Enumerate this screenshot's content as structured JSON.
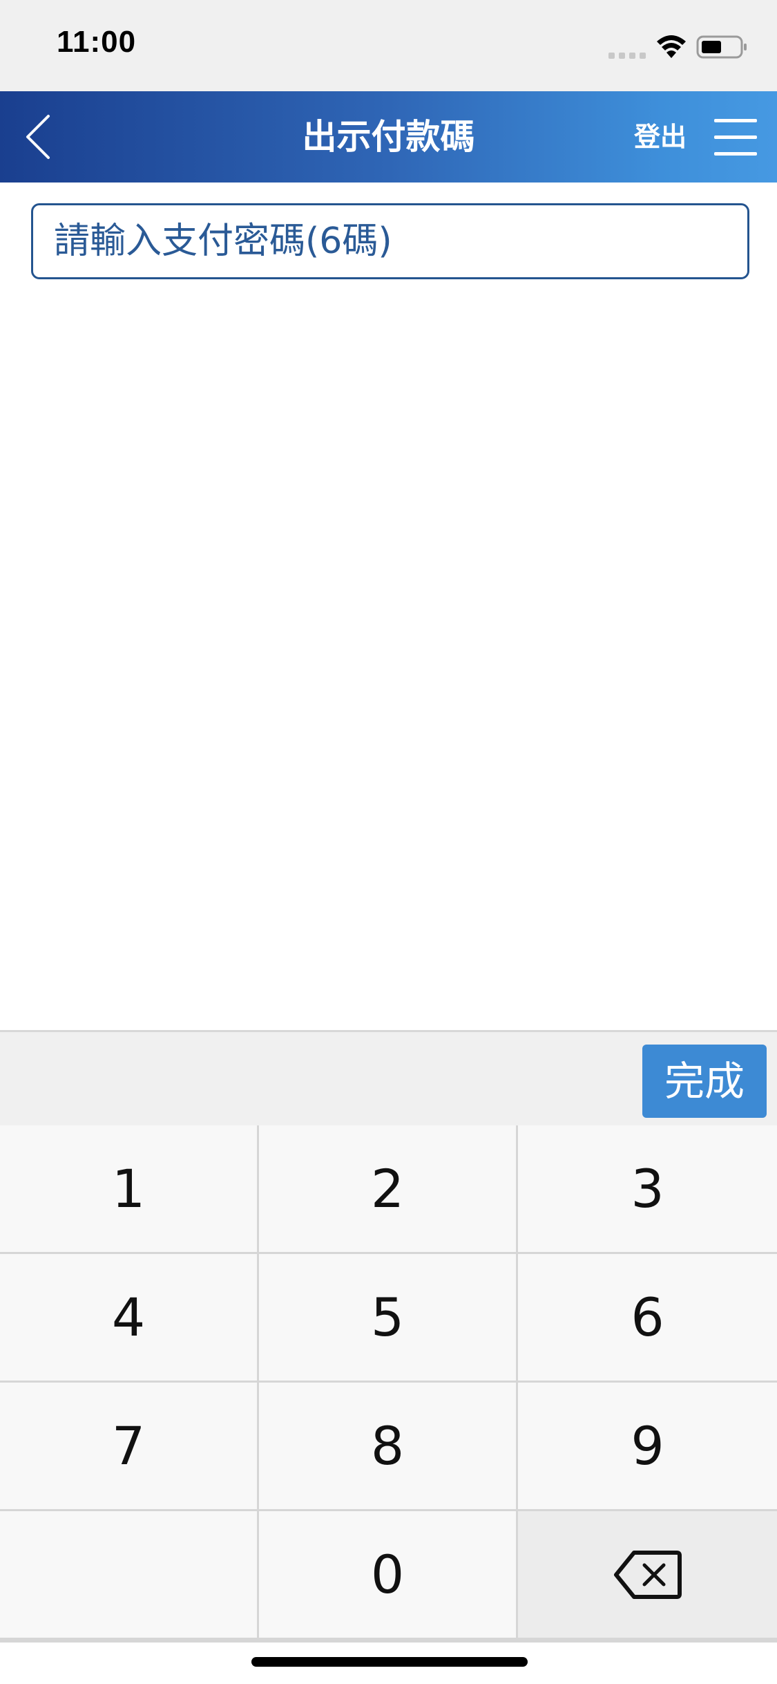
{
  "status_bar": {
    "time": "11:00",
    "icons": [
      "signal-icon",
      "wifi-icon",
      "battery-icon"
    ]
  },
  "nav": {
    "title": "出示付款碼",
    "logout_label": "登出",
    "icons": [
      "back-arrow-icon",
      "hamburger-menu-icon"
    ]
  },
  "password": {
    "placeholder": "請輸入支付密碼(6碼)",
    "value": ""
  },
  "keyboard": {
    "done_label": "完成",
    "keys": [
      "1",
      "2",
      "3",
      "4",
      "5",
      "6",
      "7",
      "8",
      "9",
      "",
      "0"
    ],
    "backspace_icon": "backspace-icon"
  },
  "colors": {
    "nav_gradient_start": "#1a3f8f",
    "nav_gradient_end": "#4699e2",
    "accent": "#3d8ad4",
    "field_border": "#24548f",
    "field_text": "#2a5a96"
  }
}
